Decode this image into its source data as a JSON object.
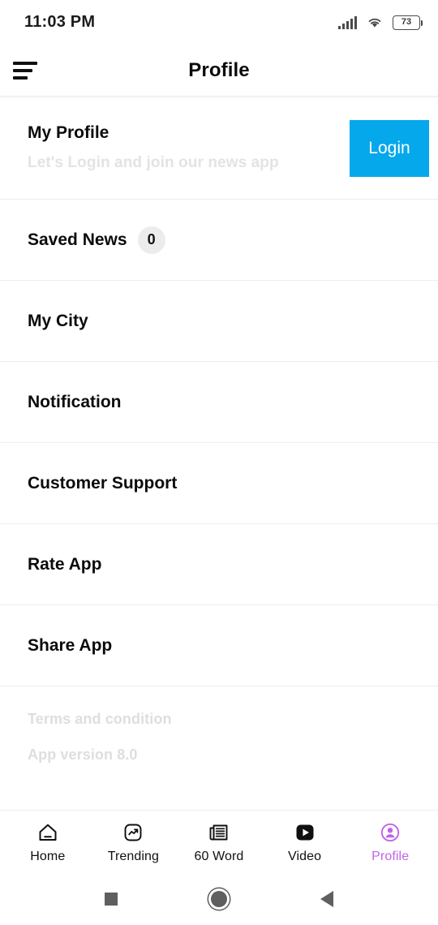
{
  "status_bar": {
    "time": "11:03 PM",
    "battery_level": "73",
    "signal_icon": "signal-bars-icon",
    "wifi_icon": "wifi-icon",
    "battery_icon": "battery-icon"
  },
  "app_bar": {
    "title": "Profile",
    "menu_icon": "hamburger-menu-icon"
  },
  "profile": {
    "title": "My Profile",
    "subtitle": "Let's Login and join our news app",
    "login_label": "Login",
    "login_color": "#05a8ea"
  },
  "menu": {
    "items": [
      {
        "label": "Saved News",
        "badge": "0"
      },
      {
        "label": "My City"
      },
      {
        "label": "Notification"
      },
      {
        "label": "Customer Support"
      },
      {
        "label": "Rate App"
      },
      {
        "label": "Share App"
      }
    ]
  },
  "footer": {
    "terms_label": "Terms and condition",
    "version_label": "App version 8.0"
  },
  "tab_bar": {
    "active_color": "#c164e8",
    "tabs": [
      {
        "label": "Home",
        "icon": "home-icon"
      },
      {
        "label": "Trending",
        "icon": "trending-icon"
      },
      {
        "label": "60 Word",
        "icon": "newspaper-icon"
      },
      {
        "label": "Video",
        "icon": "video-play-icon"
      },
      {
        "label": "Profile",
        "icon": "person-circle-icon"
      }
    ]
  },
  "nav_bar": {
    "recents_icon": "square-recents-icon",
    "home_icon": "circle-home-icon",
    "back_icon": "triangle-back-icon"
  }
}
